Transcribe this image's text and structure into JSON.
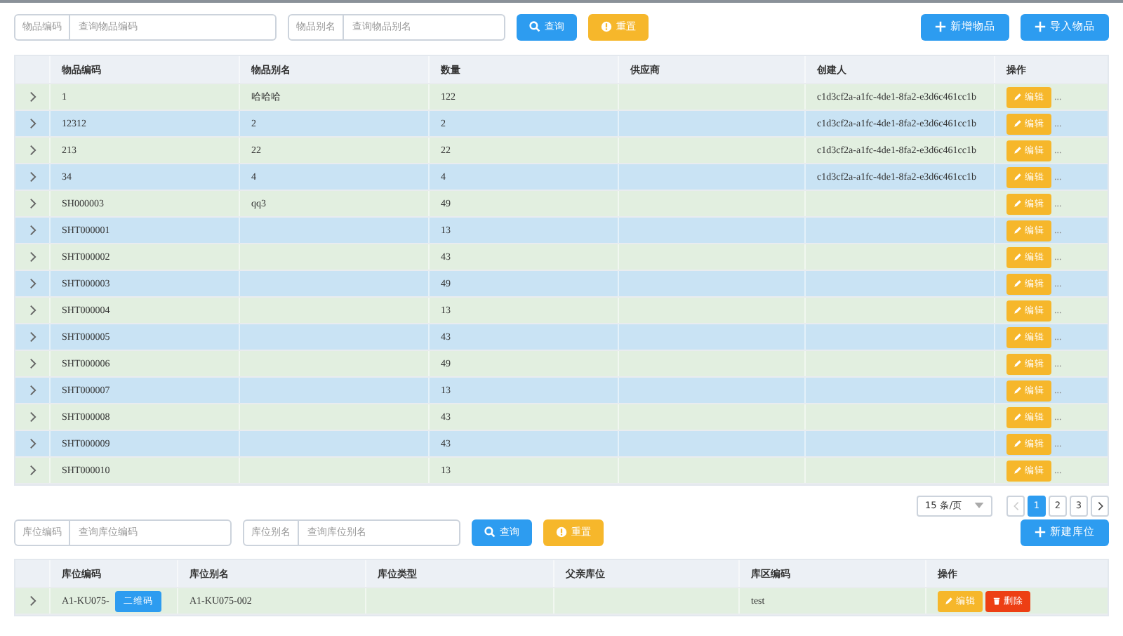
{
  "item_search": {
    "fields": [
      {
        "label": "物品编码",
        "placeholder": "查询物品编码"
      },
      {
        "label": "物品别名",
        "placeholder": "查询物品别名"
      }
    ],
    "query_button": "查询",
    "reset_button": "重置",
    "actions": [
      "新增物品",
      "导入物品"
    ]
  },
  "item_table": {
    "columns": [
      "物品编码",
      "物品别名",
      "数量",
      "供应商",
      "创建人",
      "操作"
    ],
    "rows": [
      {
        "cells": [
          "1",
          "哈哈哈",
          "122",
          "",
          "c1d3cf2a-a1fc-4de1-8fa2-e3d6c461cc1b"
        ],
        "edit": "编辑",
        "more": "..."
      },
      {
        "cells": [
          "12312",
          "2",
          "2",
          "",
          "c1d3cf2a-a1fc-4de1-8fa2-e3d6c461cc1b"
        ],
        "edit": "编辑",
        "more": "..."
      },
      {
        "cells": [
          "213",
          "22",
          "22",
          "",
          "c1d3cf2a-a1fc-4de1-8fa2-e3d6c461cc1b"
        ],
        "edit": "编辑",
        "more": "..."
      },
      {
        "cells": [
          "34",
          "4",
          "4",
          "",
          "c1d3cf2a-a1fc-4de1-8fa2-e3d6c461cc1b"
        ],
        "edit": "编辑",
        "more": "..."
      },
      {
        "cells": [
          "SH000003",
          "qq3",
          "49",
          "",
          ""
        ],
        "edit": "编辑",
        "more": "..."
      },
      {
        "cells": [
          "SHT000001",
          "",
          "13",
          "",
          ""
        ],
        "edit": "编辑",
        "more": "..."
      },
      {
        "cells": [
          "SHT000002",
          "",
          "43",
          "",
          ""
        ],
        "edit": "编辑",
        "more": "..."
      },
      {
        "cells": [
          "SHT000003",
          "",
          "49",
          "",
          ""
        ],
        "edit": "编辑",
        "more": "..."
      },
      {
        "cells": [
          "SHT000004",
          "",
          "13",
          "",
          ""
        ],
        "edit": "编辑",
        "more": "..."
      },
      {
        "cells": [
          "SHT000005",
          "",
          "43",
          "",
          ""
        ],
        "edit": "编辑",
        "more": "..."
      },
      {
        "cells": [
          "SHT000006",
          "",
          "49",
          "",
          ""
        ],
        "edit": "编辑",
        "more": "..."
      },
      {
        "cells": [
          "SHT000007",
          "",
          "13",
          "",
          ""
        ],
        "edit": "编辑",
        "more": "..."
      },
      {
        "cells": [
          "SHT000008",
          "",
          "43",
          "",
          ""
        ],
        "edit": "编辑",
        "more": "..."
      },
      {
        "cells": [
          "SHT000009",
          "",
          "43",
          "",
          ""
        ],
        "edit": "编辑",
        "more": "..."
      },
      {
        "cells": [
          "SHT000010",
          "",
          "13",
          "",
          ""
        ],
        "edit": "编辑",
        "more": "..."
      }
    ]
  },
  "pagination": {
    "page_size": "15 条/页",
    "prev_disabled": true,
    "pages": [
      {
        "label": "1",
        "selected": true
      },
      {
        "label": "2",
        "selected": false
      },
      {
        "label": "3",
        "selected": false
      }
    ]
  },
  "location_search": {
    "fields": [
      {
        "label": "库位编码",
        "placeholder": "查询库位编码"
      },
      {
        "label": "库位别名",
        "placeholder": "查询库位别名"
      }
    ],
    "query_button": "查询",
    "reset_button": "重置",
    "actions": [
      "新建库位"
    ]
  },
  "location_table": {
    "columns": [
      "库位编码",
      "库位别名",
      "库位类型",
      "父亲库位",
      "库区编码",
      "操作"
    ],
    "qr_label": "二维码",
    "edit_label": "编辑",
    "delete_label": "删除",
    "rows": [
      {
        "cells": [
          "A1-KU075-",
          "A1-KU075-002",
          "",
          "",
          "test"
        ]
      }
    ]
  }
}
